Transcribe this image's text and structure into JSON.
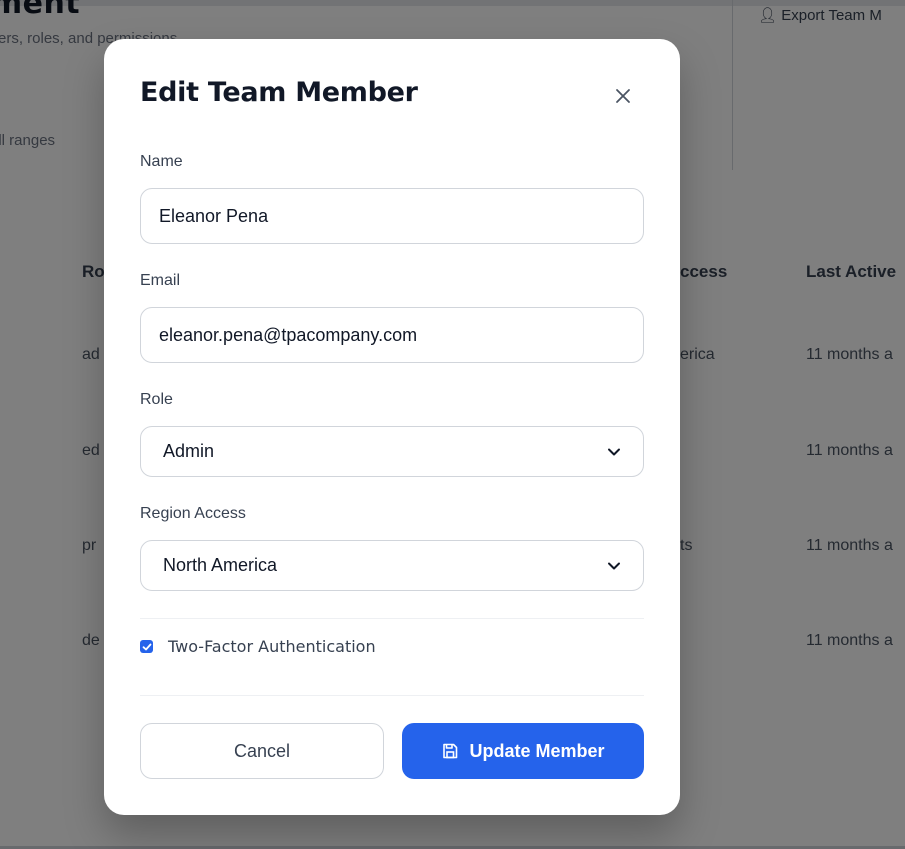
{
  "background": {
    "page_title": "ement",
    "page_subtitle": "ers, roles, and permissions",
    "export_label": "Export Team M",
    "filter_text": "all ranges",
    "table": {
      "headers": [
        "Ro",
        "ccess",
        "Last Active"
      ],
      "rows": [
        {
          "role": "ad",
          "access": "erica",
          "last_active": "11 months a"
        },
        {
          "role": "ed",
          "access": "",
          "last_active": "11 months a"
        },
        {
          "role": "pr",
          "access": "ts",
          "last_active": "11 months a"
        },
        {
          "role": "de",
          "access": "",
          "last_active": "11 months a"
        }
      ]
    }
  },
  "modal": {
    "title": "Edit Team Member",
    "fields": {
      "name": {
        "label": "Name",
        "value": "Eleanor Pena"
      },
      "email": {
        "label": "Email",
        "value": "eleanor.pena@tpacompany.com"
      },
      "role": {
        "label": "Role",
        "value": "Admin"
      },
      "region": {
        "label": "Region Access",
        "value": "North America"
      }
    },
    "two_factor": {
      "label": "Two-Factor Authentication",
      "checked": true
    },
    "buttons": {
      "cancel": "Cancel",
      "update": "Update Member"
    },
    "icons": {
      "close": "close-icon",
      "save": "save-icon",
      "chevron": "chevron-down-icon",
      "check": "checkmark-icon"
    }
  },
  "colors": {
    "accent": "#2563eb",
    "overlay": "rgba(0,0,0,0.5)",
    "text_primary": "#111827"
  }
}
